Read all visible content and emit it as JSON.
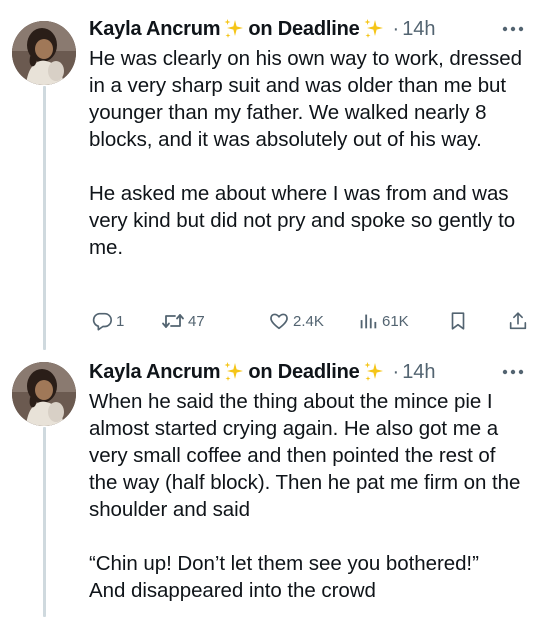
{
  "tweets": [
    {
      "author": {
        "name_start": "Kayla Ancrum",
        "name_mid": "on Deadline"
      },
      "time": "14h",
      "dot": "·",
      "text": "He was clearly on his own way to work, dressed in a very sharp suit and was older than me but younger than my father. We walked nearly 8 blocks, and it was absolutely out of his way.\n\nHe asked me about where I was from and was very kind but did not pry and spoke so gently to me.",
      "actions": {
        "replies": "1",
        "retweets": "47",
        "likes": "2.4K",
        "views": "61K"
      }
    },
    {
      "author": {
        "name_start": "Kayla Ancrum",
        "name_mid": "on Deadline"
      },
      "time": "14h",
      "dot": "·",
      "text": "When he said the thing about the mince pie I almost started crying again. He also got me a very small coffee and then pointed the rest of the way (half block). Then he pat me firm on the shoulder and said\n\n“Chin up! Don’t let them see you bothered!”\nAnd disappeared into the crowd"
    }
  ],
  "icons": {
    "sparkle": "sparkles-emoji",
    "more": "more-horizontal-icon",
    "reply": "reply-icon",
    "retweet": "retweet-icon",
    "like": "heart-icon",
    "views": "views-icon",
    "bookmark": "bookmark-icon",
    "share": "share-icon"
  },
  "colors": {
    "text": "#0f1419",
    "secondary": "#536471",
    "thread_line": "#cfd9de",
    "sparkle": "#f5c518"
  }
}
